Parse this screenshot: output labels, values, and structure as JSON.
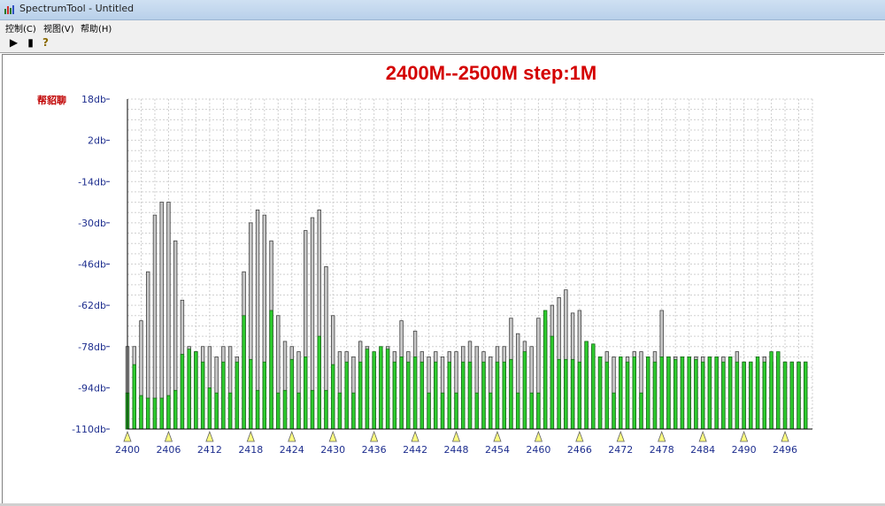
{
  "window": {
    "title": "SpectrumTool - Untitled"
  },
  "menu": {
    "items": [
      "控制(C)",
      "视图(V)",
      "帮助(H)"
    ]
  },
  "toolbar": {
    "play": "▶",
    "stop": "▮",
    "help": "?"
  },
  "chart_data": {
    "type": "bar",
    "title": "2400M--2500M step:1M",
    "ylabel": "帮貂聊",
    "xlabel": "",
    "ylim": [
      -110,
      18
    ],
    "xlim": [
      2400,
      2500
    ],
    "yticks": [
      18,
      2,
      -14,
      -30,
      -46,
      -62,
      -78,
      -94,
      -110
    ],
    "ytick_labels": [
      "18db-",
      "2db-",
      "-14db-",
      "-30db-",
      "-46db-",
      "-62db-",
      "-78db-",
      "-94db-",
      "-110db-"
    ],
    "xticks": [
      2400,
      2406,
      2412,
      2418,
      2424,
      2430,
      2436,
      2442,
      2448,
      2454,
      2460,
      2466,
      2472,
      2478,
      2484,
      2490,
      2496
    ],
    "grid": true,
    "x": [
      2400,
      2401,
      2402,
      2403,
      2404,
      2405,
      2406,
      2407,
      2408,
      2409,
      2410,
      2411,
      2412,
      2413,
      2414,
      2415,
      2416,
      2417,
      2418,
      2419,
      2420,
      2421,
      2422,
      2423,
      2424,
      2425,
      2426,
      2427,
      2428,
      2429,
      2430,
      2431,
      2432,
      2433,
      2434,
      2435,
      2436,
      2437,
      2438,
      2439,
      2440,
      2441,
      2442,
      2443,
      2444,
      2445,
      2446,
      2447,
      2448,
      2449,
      2450,
      2451,
      2452,
      2453,
      2454,
      2455,
      2456,
      2457,
      2458,
      2459,
      2460,
      2461,
      2462,
      2463,
      2464,
      2465,
      2466,
      2467,
      2468,
      2469,
      2470,
      2471,
      2472,
      2473,
      2474,
      2475,
      2476,
      2477,
      2478,
      2479,
      2480,
      2481,
      2482,
      2483,
      2484,
      2485,
      2486,
      2487,
      2488,
      2489,
      2490,
      2491,
      2492,
      2493,
      2494,
      2495,
      2496,
      2497,
      2498,
      2499
    ],
    "series": [
      {
        "color": "#c8c8c8",
        "values": [
          -78,
          -78,
          -68,
          -49,
          -27,
          -22,
          -22,
          -37,
          -60,
          -78,
          -80,
          -78,
          -78,
          -82,
          -78,
          -78,
          -82,
          -49,
          -30,
          -25,
          -27,
          -37,
          -66,
          -76,
          -78,
          -80,
          -33,
          -28,
          -25,
          -47,
          -66,
          -80,
          -80,
          -82,
          -76,
          -78,
          -82,
          -80,
          -78,
          -80,
          -68,
          -80,
          -72,
          -80,
          -82,
          -80,
          -82,
          -80,
          -80,
          -78,
          -76,
          -78,
          -80,
          -82,
          -78,
          -78,
          -67,
          -73,
          -76,
          -78,
          -67,
          -68,
          -62,
          -59,
          -56,
          -65,
          -64,
          -76,
          -78,
          -82,
          -80,
          -82,
          -82,
          -82,
          -80,
          -80,
          -82,
          -80,
          -64,
          -82,
          -82,
          -82,
          -82,
          -82,
          -82,
          -82,
          -82,
          -82,
          -82,
          -80,
          -84,
          -84,
          -84,
          -82,
          -84,
          -82,
          -84,
          -84,
          -84,
          -84
        ]
      },
      {
        "color": "#2ecc2e",
        "values": [
          -96,
          -85,
          -97,
          -98,
          -98,
          -98,
          -97,
          -95,
          -81,
          -79,
          -80,
          -84,
          -94,
          -96,
          -84,
          -96,
          -84,
          -66,
          -83,
          -95,
          -84,
          -64,
          -96,
          -95,
          -83,
          -96,
          -82,
          -95,
          -74,
          -95,
          -85,
          -96,
          -84,
          -96,
          -84,
          -79,
          -80,
          -78,
          -79,
          -84,
          -82,
          -84,
          -82,
          -84,
          -96,
          -84,
          -96,
          -84,
          -96,
          -84,
          -84,
          -96,
          -84,
          -96,
          -84,
          -84,
          -83,
          -96,
          -80,
          -96,
          -96,
          -64,
          -74,
          -83,
          -83,
          -83,
          -84,
          -76,
          -77,
          -82,
          -84,
          -96,
          -82,
          -84,
          -82,
          -96,
          -82,
          -84,
          -82,
          -82,
          -83,
          -82,
          -82,
          -83,
          -84,
          -82,
          -82,
          -84,
          -82,
          -84,
          -84,
          -84,
          -82,
          -84,
          -80,
          -80,
          -84,
          -84,
          -84,
          -84
        ]
      }
    ]
  }
}
